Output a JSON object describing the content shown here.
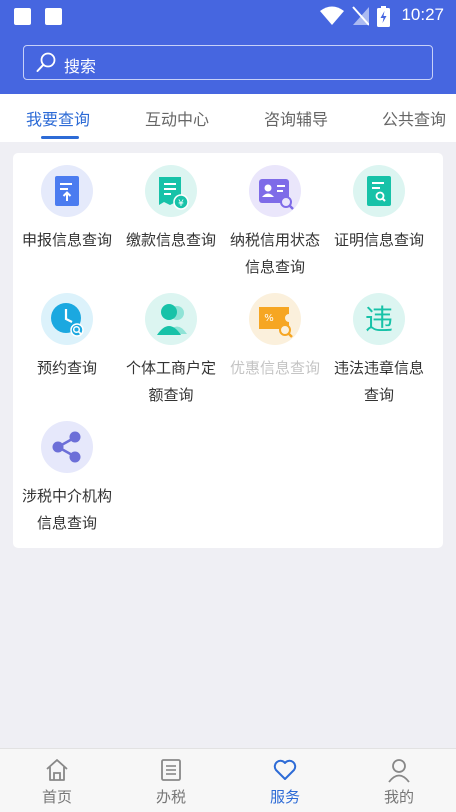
{
  "status": {
    "time": "10:27"
  },
  "search": {
    "placeholder": "搜索"
  },
  "tabs": [
    {
      "label": "我要查询",
      "active": true
    },
    {
      "label": "互动中心",
      "active": false
    },
    {
      "label": "咨询辅导",
      "active": false
    },
    {
      "label": "公共查询",
      "active": false
    }
  ],
  "services": [
    {
      "label": "申报信息查询",
      "icon": "declare-doc-icon",
      "enabled": true
    },
    {
      "label": "缴款信息查询",
      "icon": "payment-doc-icon",
      "enabled": true
    },
    {
      "label": "纳税信用状态信息查询",
      "icon": "id-card-search-icon",
      "enabled": true
    },
    {
      "label": "证明信息查询",
      "icon": "certificate-search-icon",
      "enabled": true
    },
    {
      "label": "预约查询",
      "icon": "clock-search-icon",
      "enabled": true
    },
    {
      "label": "个体工商户定额查询",
      "icon": "person-icon",
      "enabled": true
    },
    {
      "label": "优惠信息查询",
      "icon": "discount-ticket-icon",
      "enabled": false
    },
    {
      "label": "违法违章信息查询",
      "icon": "violation-character-icon",
      "enabled": true,
      "glyph": "违"
    },
    {
      "label": "涉税中介机构信息查询",
      "icon": "share-icon",
      "enabled": true
    }
  ],
  "bottom_nav": [
    {
      "label": "首页",
      "icon": "home-icon",
      "active": false
    },
    {
      "label": "办税",
      "icon": "list-icon",
      "active": false
    },
    {
      "label": "服务",
      "icon": "heart-icon",
      "active": true
    },
    {
      "label": "我的",
      "icon": "user-icon",
      "active": false
    }
  ]
}
